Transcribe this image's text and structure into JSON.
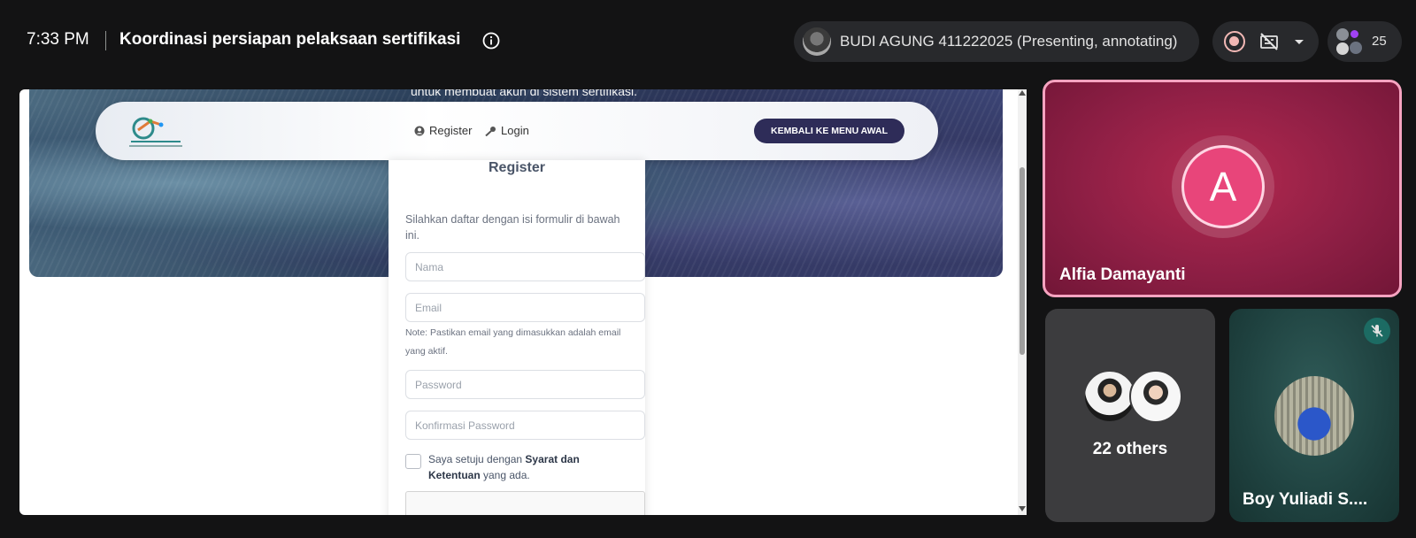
{
  "topbar": {
    "time": "7:33 PM",
    "meeting_title": "Koordinasi persiapan pelaksaan sertifikasi",
    "presenter_label": "BUDI AGUNG 411222025 (Presenting, annotating)",
    "participant_count": "25"
  },
  "shared_screen": {
    "hero_text": "untuk membuat akun di sistem sertifikasi.",
    "nav": {
      "register": "Register",
      "login": "Login",
      "back_button": "KEMBALI KE MENU AWAL"
    },
    "form": {
      "title": "Register",
      "description": "Silahkan daftar dengan isi formulir di bawah ini.",
      "name_placeholder": "Nama",
      "email_placeholder": "Email",
      "email_note": "Note: Pastikan email yang dimasukkan adalah email yang aktif.",
      "password_placeholder": "Password",
      "confirm_placeholder": "Konfirmasi Password",
      "agree_prefix": "Saya setuju dengan ",
      "agree_link": "Syarat dan Ketentuan",
      "agree_suffix": " yang ada."
    }
  },
  "tiles": {
    "speaker": {
      "name": "Alfia Damayanti",
      "initial": "A"
    },
    "others_label": "22 others",
    "boy": {
      "name": "Boy Yuliadi S...."
    }
  },
  "colors": {
    "background": "#131314",
    "pill": "#28292c",
    "speaker_tile": "#8f1f45",
    "speaker_border": "#f6a3c0",
    "avatar": "#e8457a",
    "nav_button": "#2e2c58"
  },
  "icons": [
    "info-icon",
    "record-icon",
    "no-captions-icon",
    "chevron-down-icon",
    "user-icon",
    "key-icon",
    "mic-off-icon"
  ]
}
